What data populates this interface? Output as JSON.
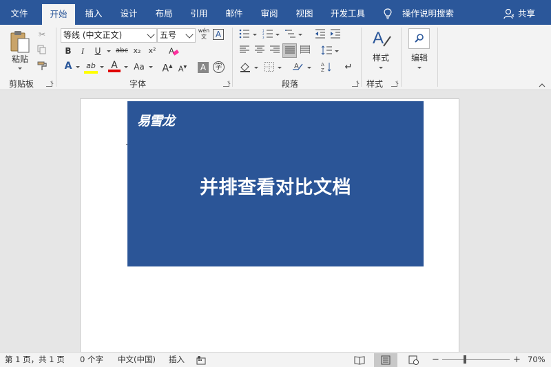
{
  "tabs": [
    "文件",
    "开始",
    "插入",
    "设计",
    "布局",
    "引用",
    "邮件",
    "审阅",
    "视图",
    "开发工具"
  ],
  "active_tab": "开始",
  "tell_me": "操作说明搜索",
  "share": "共享",
  "clipboard": {
    "paste": "粘贴",
    "group": "剪贴板"
  },
  "font": {
    "name": "等线 (中文正文)",
    "size": "五号",
    "pinyin": "wén",
    "bold": "B",
    "italic": "I",
    "underline": "U",
    "strike": "abc",
    "subscript": "x₂",
    "superscript": "x²",
    "case": "Aa",
    "grow": "A",
    "shrink": "A",
    "charborder": "A",
    "enclose": "字",
    "highlight": "ab",
    "fontcolor": "A",
    "group": "字体"
  },
  "paragraph": {
    "group": "段落"
  },
  "styles": {
    "label": "样式",
    "group": "样式"
  },
  "editing": {
    "label": "编辑"
  },
  "document": {
    "logo": "易雪龙",
    "headline": "并排查看对比文档"
  },
  "status": {
    "page": "第 1 页，共 1 页",
    "words": "0 个字",
    "lang": "中文(中国)",
    "mode": "插入",
    "zoom_minus": "−",
    "zoom_plus": "+",
    "zoom": "70%"
  },
  "colors": {
    "brand": "#2b579a",
    "banner": "#2b5597",
    "highlight_bar": "#ffff00",
    "fontcolor_bar": "#e00000"
  }
}
